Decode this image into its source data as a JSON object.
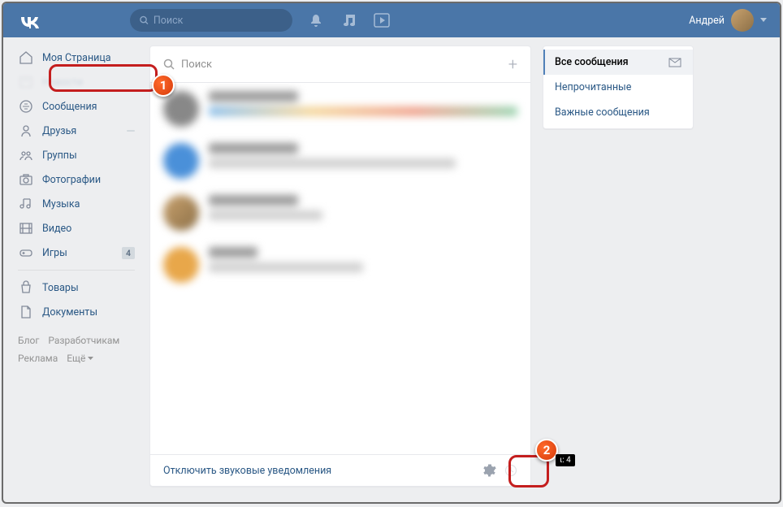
{
  "header": {
    "search_placeholder": "Поиск",
    "username": "Андрей"
  },
  "sidebar": {
    "items": [
      {
        "label": "Моя Страница",
        "icon": "home"
      },
      {
        "label": "Новости",
        "icon": "news"
      },
      {
        "label": "Сообщения",
        "icon": "messages"
      },
      {
        "label": "Друзья",
        "icon": "friends",
        "badge": ""
      },
      {
        "label": "Группы",
        "icon": "groups"
      },
      {
        "label": "Фотографии",
        "icon": "photos"
      },
      {
        "label": "Музыка",
        "icon": "music"
      },
      {
        "label": "Видео",
        "icon": "video"
      },
      {
        "label": "Игры",
        "icon": "games",
        "badge": "4"
      }
    ],
    "lower_items": [
      {
        "label": "Товары",
        "icon": "market"
      },
      {
        "label": "Документы",
        "icon": "docs"
      }
    ],
    "footer": {
      "blog": "Блог",
      "developers": "Разработчикам",
      "ads": "Реклама",
      "more": "Ещё"
    }
  },
  "messages": {
    "search_placeholder": "Поиск",
    "disable_sound": "Отключить звуковые уведомления"
  },
  "filters": {
    "all": "Все сообщения",
    "unread": "Непрочитанные",
    "important": "Важные сообщения"
  },
  "callouts": {
    "one": "1",
    "two": "2"
  },
  "tooltip": "ι: 4"
}
